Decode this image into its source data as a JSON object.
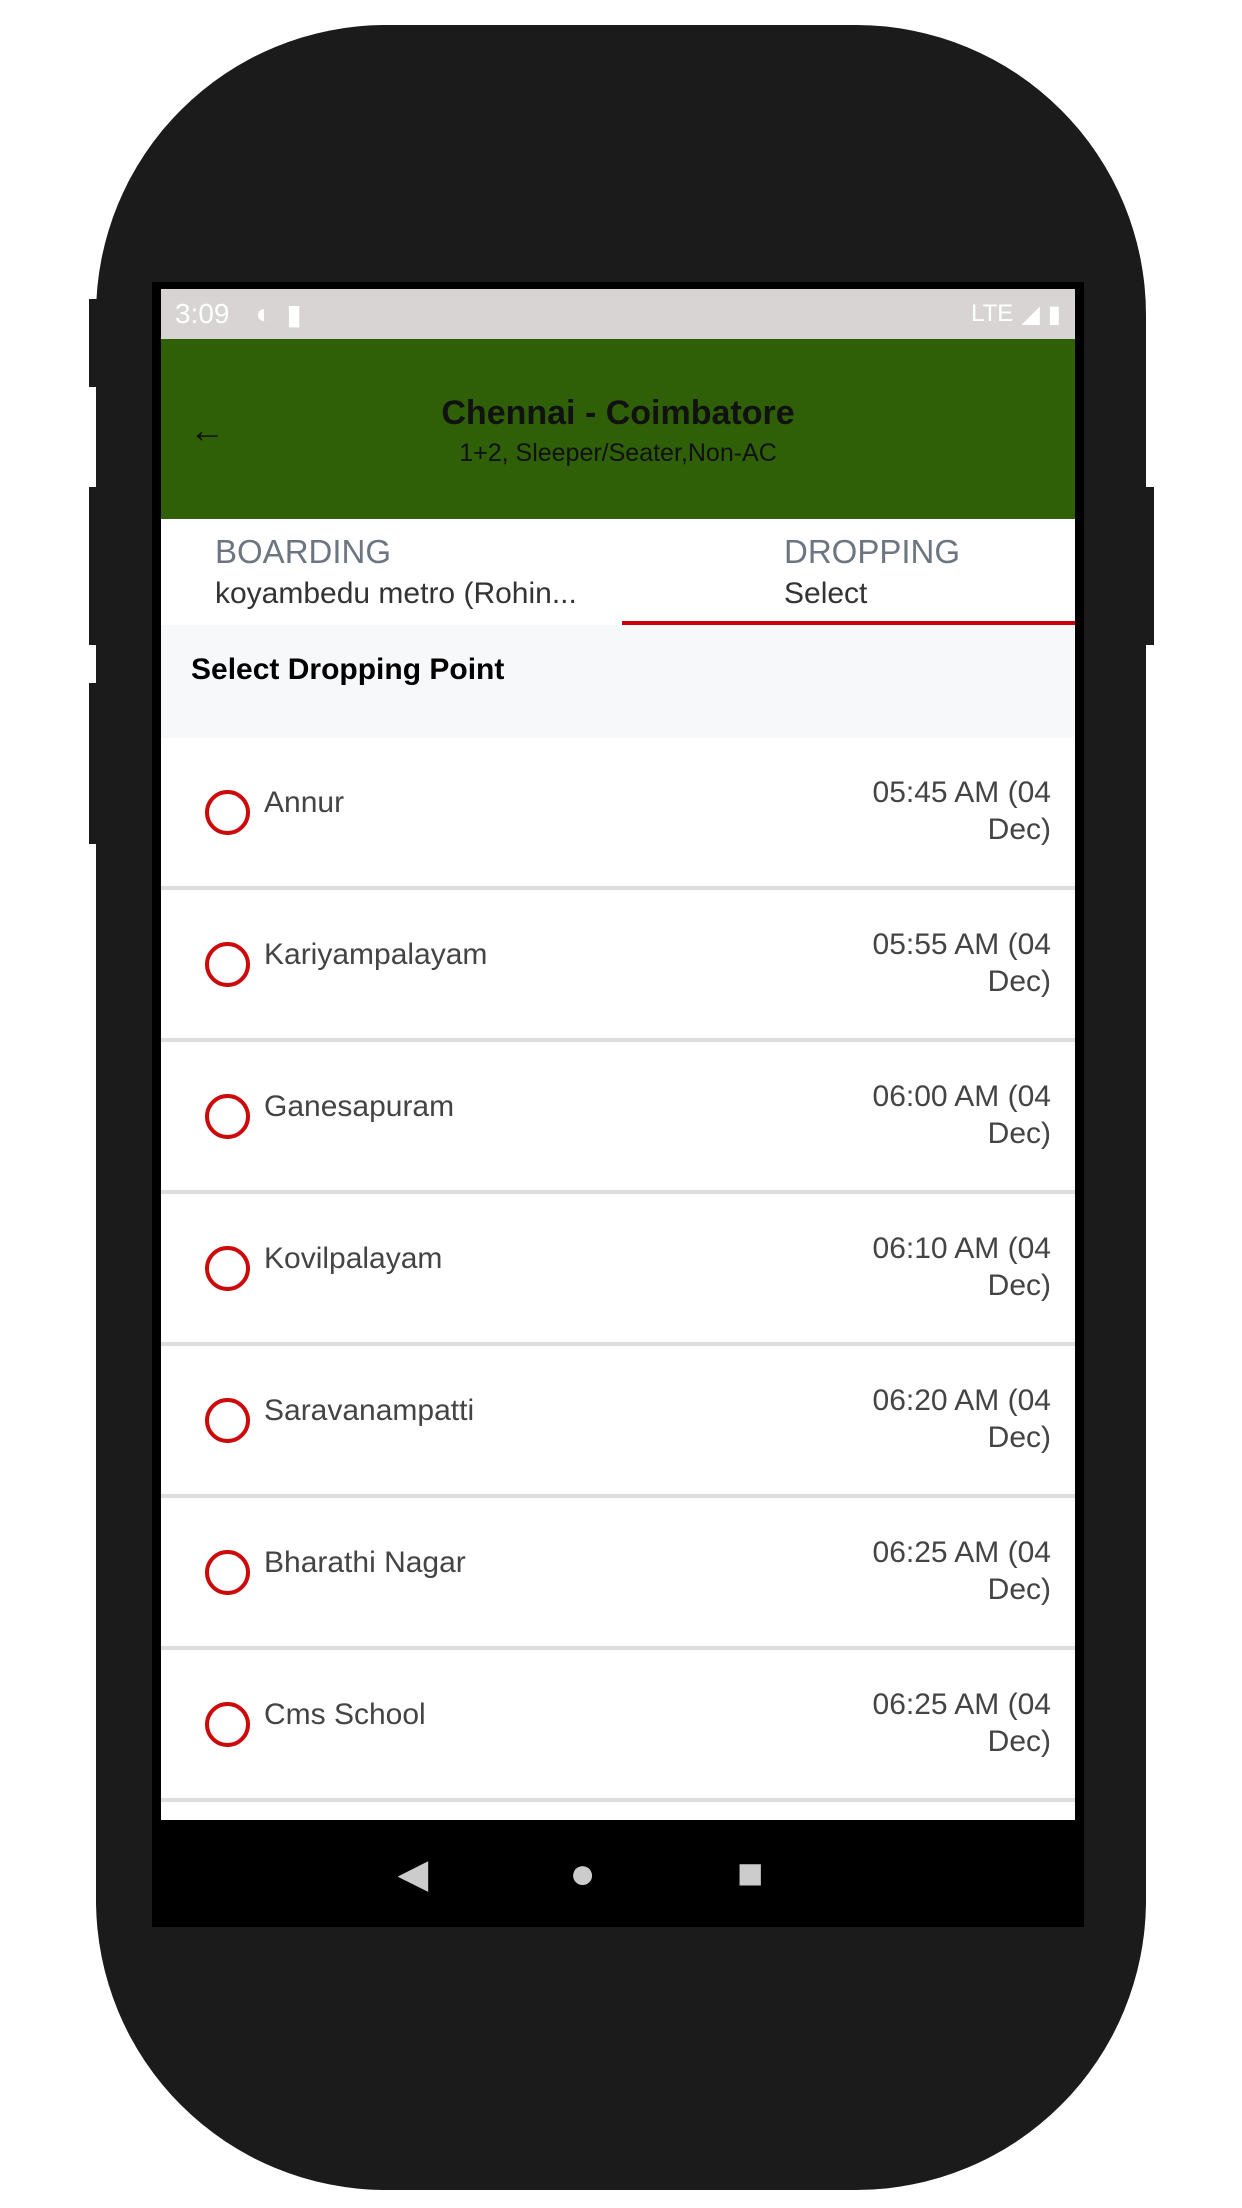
{
  "status_bar": {
    "time": "3:09",
    "network": "LTE"
  },
  "header": {
    "title": "Chennai - Coimbatore",
    "subtitle": "1+2, Sleeper/Seater,Non-AC"
  },
  "tabs": [
    {
      "label": "BOARDING",
      "value": "koyambedu metro (Rohin..."
    },
    {
      "label": "DROPPING",
      "value": "Select",
      "active": true
    }
  ],
  "section_title": "Select Dropping Point",
  "points": [
    {
      "name": "Annur",
      "time": "05:45 AM (04 Dec)"
    },
    {
      "name": "Kariyampalayam",
      "time": "05:55 AM (04 Dec)"
    },
    {
      "name": "Ganesapuram",
      "time": "06:00 AM (04 Dec)"
    },
    {
      "name": "Kovilpalayam",
      "time": "06:10 AM (04 Dec)"
    },
    {
      "name": "Saravanampatti",
      "time": "06:20 AM (04 Dec)"
    },
    {
      "name": "Bharathi Nagar",
      "time": "06:25 AM (04 Dec)"
    },
    {
      "name": "Cms School",
      "time": "06:25 AM (04 Dec)"
    }
  ],
  "colors": {
    "header": "#2f5f07",
    "accent": "#c8000a",
    "status_bar": "#d8d4d3"
  }
}
